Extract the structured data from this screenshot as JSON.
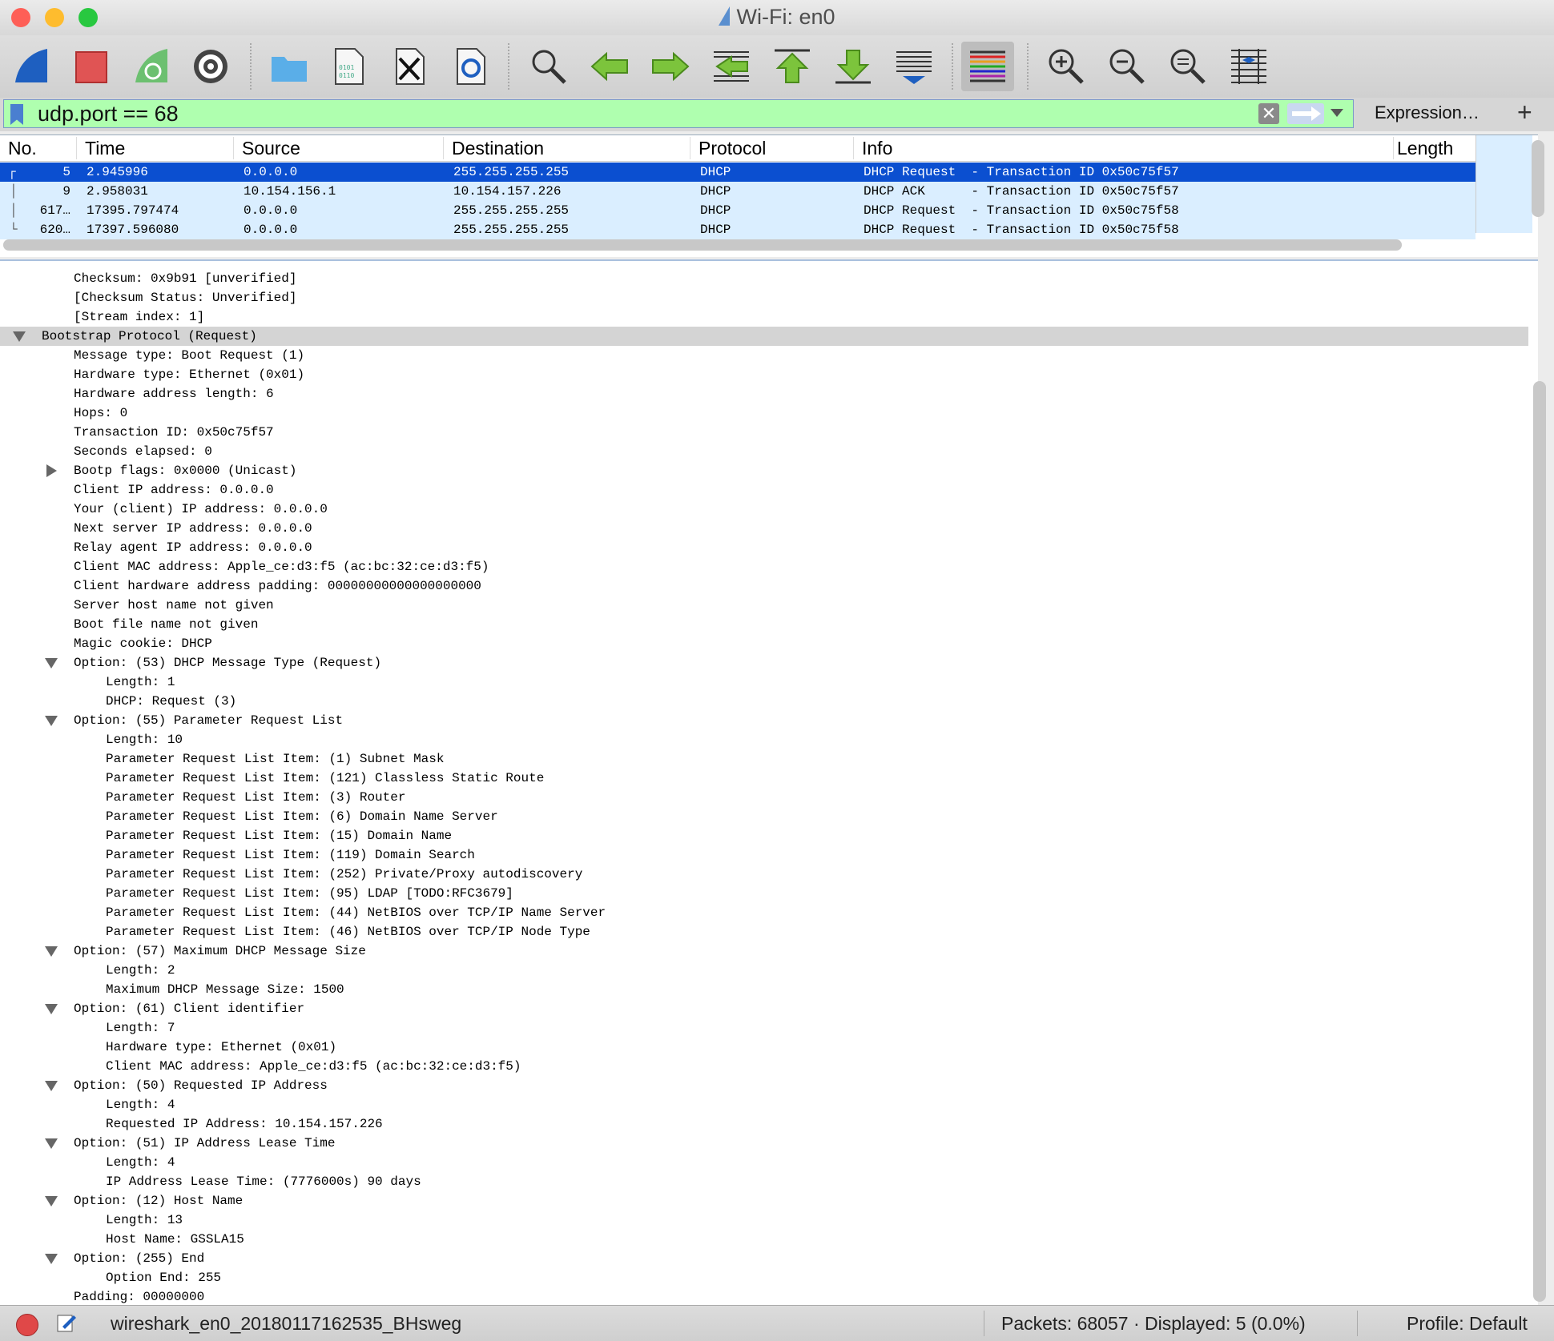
{
  "window": {
    "title": "Wi-Fi: en0",
    "traffic_colors": [
      "#fe5f57",
      "#febc2e",
      "#28c840"
    ]
  },
  "toolbar": {
    "buttons": [
      "start-capture-icon",
      "stop-capture-icon",
      "restart-capture-icon",
      "capture-options-icon",
      "open-file-icon",
      "save-file-icon",
      "close-file-icon",
      "reload-file-icon",
      "find-packet-icon",
      "go-back-icon",
      "go-forward-icon",
      "go-to-packet-icon",
      "go-first-packet-icon",
      "go-last-packet-icon",
      "autoscroll-icon",
      "colorize-icon",
      "zoom-in-icon",
      "zoom-out-icon",
      "zoom-normal-icon",
      "resize-columns-icon"
    ]
  },
  "filter": {
    "value": "udp.port == 68",
    "expression_label": "Expression…",
    "plus_label": "+",
    "clear_label": "✕",
    "bg_color": "#afffaf"
  },
  "packet_list": {
    "columns": [
      "No.",
      "Time",
      "Source",
      "Destination",
      "Protocol",
      "Info",
      "Length"
    ],
    "rows": [
      {
        "no": "5",
        "time": "2.945996",
        "source": "0.0.0.0",
        "destination": "255.255.255.255",
        "protocol": "DHCP",
        "info": "DHCP Request  - Transaction ID 0x50c75f57",
        "selected": true
      },
      {
        "no": "9",
        "time": "2.958031",
        "source": "10.154.156.1",
        "destination": "10.154.157.226",
        "protocol": "DHCP",
        "info": "DHCP ACK      - Transaction ID 0x50c75f57",
        "selected": false
      },
      {
        "no": "617…",
        "time": "17395.797474",
        "source": "0.0.0.0",
        "destination": "255.255.255.255",
        "protocol": "DHCP",
        "info": "DHCP Request  - Transaction ID 0x50c75f58",
        "selected": false
      },
      {
        "no": "620…",
        "time": "17397.596080",
        "source": "0.0.0.0",
        "destination": "255.255.255.255",
        "protocol": "DHCP",
        "info": "DHCP Request  - Transaction ID 0x50c75f58",
        "selected": false
      }
    ],
    "selected_color": "#0b4fd0",
    "row_color": "#daeeff"
  },
  "details": [
    {
      "text": "Checksum: 0x9b91 [unverified]",
      "level": 1,
      "toggle": "none"
    },
    {
      "text": "[Checksum Status: Unverified]",
      "level": 1,
      "toggle": "none"
    },
    {
      "text": "[Stream index: 1]",
      "level": 1,
      "toggle": "none"
    },
    {
      "text": "Bootstrap Protocol (Request)",
      "level": 0,
      "toggle": "open",
      "highlight": true
    },
    {
      "text": "Message type: Boot Request (1)",
      "level": 1,
      "toggle": "none"
    },
    {
      "text": "Hardware type: Ethernet (0x01)",
      "level": 1,
      "toggle": "none"
    },
    {
      "text": "Hardware address length: 6",
      "level": 1,
      "toggle": "none"
    },
    {
      "text": "Hops: 0",
      "level": 1,
      "toggle": "none"
    },
    {
      "text": "Transaction ID: 0x50c75f57",
      "level": 1,
      "toggle": "none"
    },
    {
      "text": "Seconds elapsed: 0",
      "level": 1,
      "toggle": "none"
    },
    {
      "text": "Bootp flags: 0x0000 (Unicast)",
      "level": 1,
      "toggle": "closed"
    },
    {
      "text": "Client IP address: 0.0.0.0",
      "level": 1,
      "toggle": "none"
    },
    {
      "text": "Your (client) IP address: 0.0.0.0",
      "level": 1,
      "toggle": "none"
    },
    {
      "text": "Next server IP address: 0.0.0.0",
      "level": 1,
      "toggle": "none"
    },
    {
      "text": "Relay agent IP address: 0.0.0.0",
      "level": 1,
      "toggle": "none"
    },
    {
      "text": "Client MAC address: Apple_ce:d3:f5 (ac:bc:32:ce:d3:f5)",
      "level": 1,
      "toggle": "none"
    },
    {
      "text": "Client hardware address padding: 00000000000000000000",
      "level": 1,
      "toggle": "none"
    },
    {
      "text": "Server host name not given",
      "level": 1,
      "toggle": "none"
    },
    {
      "text": "Boot file name not given",
      "level": 1,
      "toggle": "none"
    },
    {
      "text": "Magic cookie: DHCP",
      "level": 1,
      "toggle": "none"
    },
    {
      "text": "Option: (53) DHCP Message Type (Request)",
      "level": 1,
      "toggle": "open"
    },
    {
      "text": "Length: 1",
      "level": 2,
      "toggle": "none"
    },
    {
      "text": "DHCP: Request (3)",
      "level": 2,
      "toggle": "none"
    },
    {
      "text": "Option: (55) Parameter Request List",
      "level": 1,
      "toggle": "open"
    },
    {
      "text": "Length: 10",
      "level": 2,
      "toggle": "none"
    },
    {
      "text": "Parameter Request List Item: (1) Subnet Mask",
      "level": 2,
      "toggle": "none"
    },
    {
      "text": "Parameter Request List Item: (121) Classless Static Route",
      "level": 2,
      "toggle": "none"
    },
    {
      "text": "Parameter Request List Item: (3) Router",
      "level": 2,
      "toggle": "none"
    },
    {
      "text": "Parameter Request List Item: (6) Domain Name Server",
      "level": 2,
      "toggle": "none"
    },
    {
      "text": "Parameter Request List Item: (15) Domain Name",
      "level": 2,
      "toggle": "none"
    },
    {
      "text": "Parameter Request List Item: (119) Domain Search",
      "level": 2,
      "toggle": "none"
    },
    {
      "text": "Parameter Request List Item: (252) Private/Proxy autodiscovery",
      "level": 2,
      "toggle": "none"
    },
    {
      "text": "Parameter Request List Item: (95) LDAP [TODO:RFC3679]",
      "level": 2,
      "toggle": "none"
    },
    {
      "text": "Parameter Request List Item: (44) NetBIOS over TCP/IP Name Server",
      "level": 2,
      "toggle": "none"
    },
    {
      "text": "Parameter Request List Item: (46) NetBIOS over TCP/IP Node Type",
      "level": 2,
      "toggle": "none"
    },
    {
      "text": "Option: (57) Maximum DHCP Message Size",
      "level": 1,
      "toggle": "open"
    },
    {
      "text": "Length: 2",
      "level": 2,
      "toggle": "none"
    },
    {
      "text": "Maximum DHCP Message Size: 1500",
      "level": 2,
      "toggle": "none"
    },
    {
      "text": "Option: (61) Client identifier",
      "level": 1,
      "toggle": "open"
    },
    {
      "text": "Length: 7",
      "level": 2,
      "toggle": "none"
    },
    {
      "text": "Hardware type: Ethernet (0x01)",
      "level": 2,
      "toggle": "none"
    },
    {
      "text": "Client MAC address: Apple_ce:d3:f5 (ac:bc:32:ce:d3:f5)",
      "level": 2,
      "toggle": "none"
    },
    {
      "text": "Option: (50) Requested IP Address",
      "level": 1,
      "toggle": "open"
    },
    {
      "text": "Length: 4",
      "level": 2,
      "toggle": "none"
    },
    {
      "text": "Requested IP Address: 10.154.157.226",
      "level": 2,
      "toggle": "none"
    },
    {
      "text": "Option: (51) IP Address Lease Time",
      "level": 1,
      "toggle": "open"
    },
    {
      "text": "Length: 4",
      "level": 2,
      "toggle": "none"
    },
    {
      "text": "IP Address Lease Time: (7776000s) 90 days",
      "level": 2,
      "toggle": "none"
    },
    {
      "text": "Option: (12) Host Name",
      "level": 1,
      "toggle": "open"
    },
    {
      "text": "Length: 13",
      "level": 2,
      "toggle": "none"
    },
    {
      "text": "Host Name: GSSLA15",
      "level": 2,
      "toggle": "none"
    },
    {
      "text": "Option: (255) End",
      "level": 1,
      "toggle": "open"
    },
    {
      "text": "Option End: 255",
      "level": 2,
      "toggle": "none"
    },
    {
      "text": "Padding: 00000000",
      "level": 1,
      "toggle": "none"
    }
  ],
  "status": {
    "file": "wireshark_en0_20180117162535_BHsweg",
    "packets": "Packets: 68057 · Displayed: 5 (0.0%)",
    "profile": "Profile: Default"
  }
}
